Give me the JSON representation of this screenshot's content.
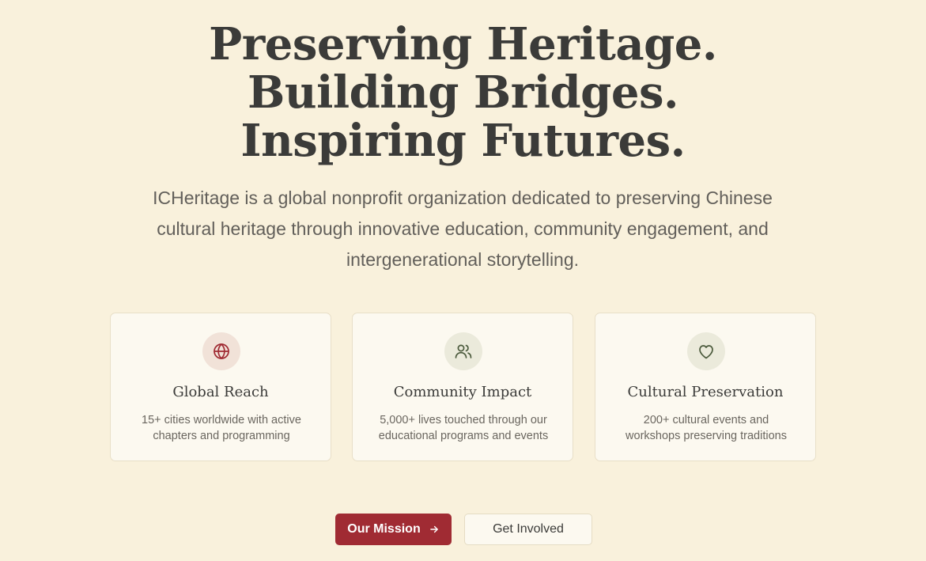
{
  "hero": {
    "title_lines": [
      "Preserving Heritage.",
      "Building Bridges.",
      "Inspiring Futures."
    ],
    "subtitle": "ICHeritage is a global nonprofit organization dedicated to preserving Chinese cultural heritage through innovative education, community engagement, and intergenerational storytelling."
  },
  "cards": [
    {
      "icon": "globe-icon",
      "title": "Global Reach",
      "desc": "15+ cities worldwide with active chapters and programming"
    },
    {
      "icon": "users-icon",
      "title": "Community Impact",
      "desc": "5,000+ lives touched through our educational programs and events"
    },
    {
      "icon": "heart-icon",
      "title": "Cultural Preservation",
      "desc": "200+ cultural events and workshops preserving traditions"
    }
  ],
  "actions": {
    "primary_label": "Our Mission",
    "secondary_label": "Get Involved"
  },
  "colors": {
    "background": "#f9f1dc",
    "accent": "#a02b33",
    "icon_green": "#4b5a3c"
  }
}
